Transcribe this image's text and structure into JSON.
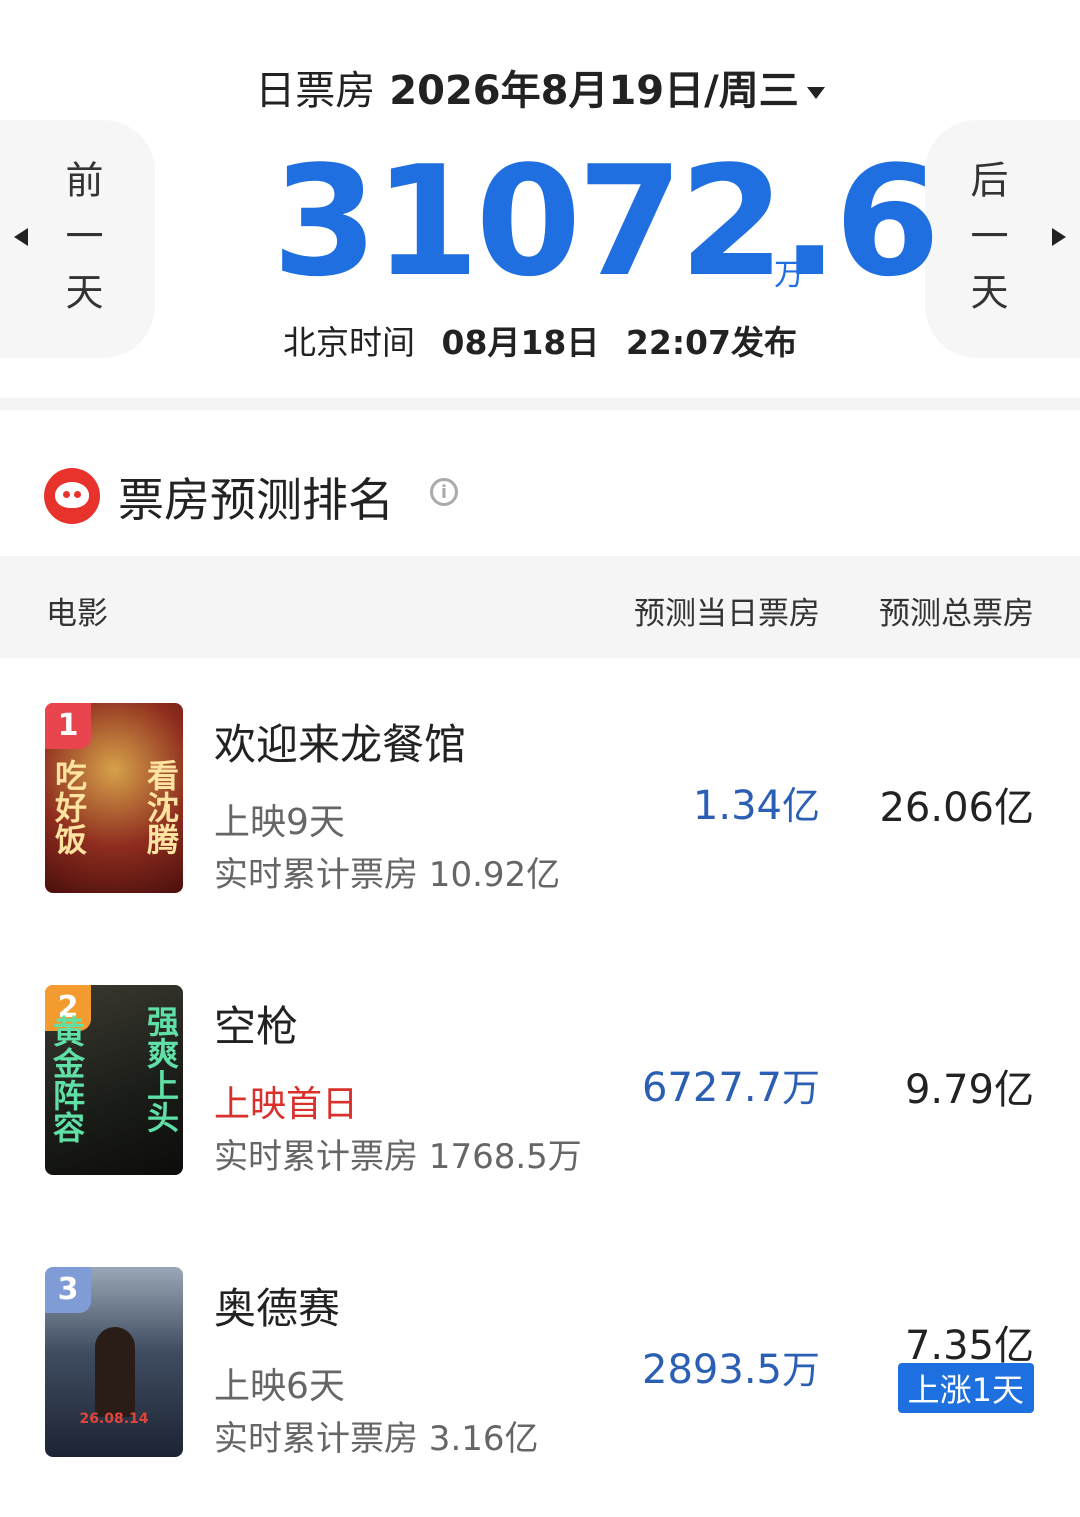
{
  "header": {
    "label": "日票房",
    "date": "2026年8月19日/周三",
    "prev_label": "前一天",
    "next_label": "后一天",
    "box_office": "31072.6",
    "unit": "万",
    "publish_prefix": "北京时间",
    "publish_date": "08月18日",
    "publish_time": "22:07发布"
  },
  "section": {
    "title": "票房预测排名"
  },
  "table": {
    "col_movie": "电影",
    "col_today": "预测当日票房",
    "col_total": "预测总票房"
  },
  "movies": [
    {
      "rank": "1",
      "title": "欢迎来龙餐馆",
      "days": "上映9天",
      "cumulative": "实时累计票房 10.92亿",
      "today_value": "1.34",
      "today_unit": "亿",
      "total": "26.06亿",
      "poster_left": "吃好饭",
      "poster_right": "看沈腾"
    },
    {
      "rank": "2",
      "title": "空枪",
      "days": "上映首日",
      "cumulative": "实时累计票房 1768.5万",
      "today_value": "6727.7",
      "today_unit": "万",
      "total": "9.79亿",
      "poster_left": "黄金阵容",
      "poster_right": "强爽上头"
    },
    {
      "rank": "3",
      "title": "奥德赛",
      "days": "上映6天",
      "cumulative": "实时累计票房 3.16亿",
      "today_value": "2893.5",
      "today_unit": "万",
      "total": "7.35亿",
      "badge": "上涨1天",
      "poster_date": "26.08.14"
    }
  ],
  "colors": {
    "accent": "#1f6fe0",
    "rank1": "#e8454f",
    "rank2": "#f39b2f",
    "rank3": "#7f9cd6",
    "first_day": "#d9302c"
  }
}
